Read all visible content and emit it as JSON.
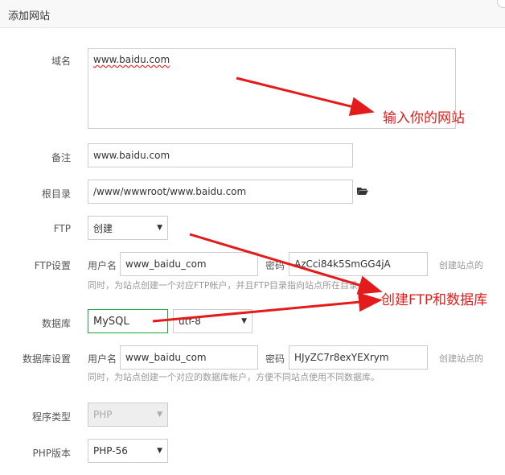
{
  "dialog": {
    "title": "添加网站"
  },
  "labels": {
    "domain": "域名",
    "remark": "备注",
    "root": "根目录",
    "ftp": "FTP",
    "ftp_settings": "FTP设置",
    "database": "数据库",
    "db_settings": "数据库设置",
    "program_type": "程序类型",
    "php_version": "PHP版本"
  },
  "fields": {
    "domain_value": "www.baidu.com",
    "remark_value": "www.baidu.com",
    "root_value": "/www/wwwroot/www.baidu.com",
    "ftp_select": "创建",
    "ftp_user_label": "用户名",
    "ftp_user": "www_baidu_com",
    "ftp_pass_label": "密码",
    "ftp_pass": "AzCci84k5SmGG4jA",
    "ftp_hint_line1": "创建站点的",
    "ftp_hint_line2": "同时，为站点创建一个对应FTP帐户，并且FTP目录指向站点所在目录。",
    "db_select": "MySQL",
    "db_charset": "utf-8",
    "db_user_label": "用户名",
    "db_user": "www_baidu_com",
    "db_pass_label": "密码",
    "db_pass": "HJyZC7r8exYEXrym",
    "db_hint_line1": "创建站点的",
    "db_hint_line2": "同时，为站点创建一个对应的数据库帐户，方便不同站点使用不同数据库。",
    "program_type": "PHP",
    "php_version": "PHP-56"
  },
  "annotations": {
    "input_site": "输入你的网站",
    "create_ftp_db": "创建FTP和数据库"
  },
  "colors": {
    "accent_green": "#20a53a",
    "annotation_red": "#e31b1b"
  },
  "icons": [
    "folder-open-icon",
    "chevron-down-icon",
    "close-icon"
  ]
}
